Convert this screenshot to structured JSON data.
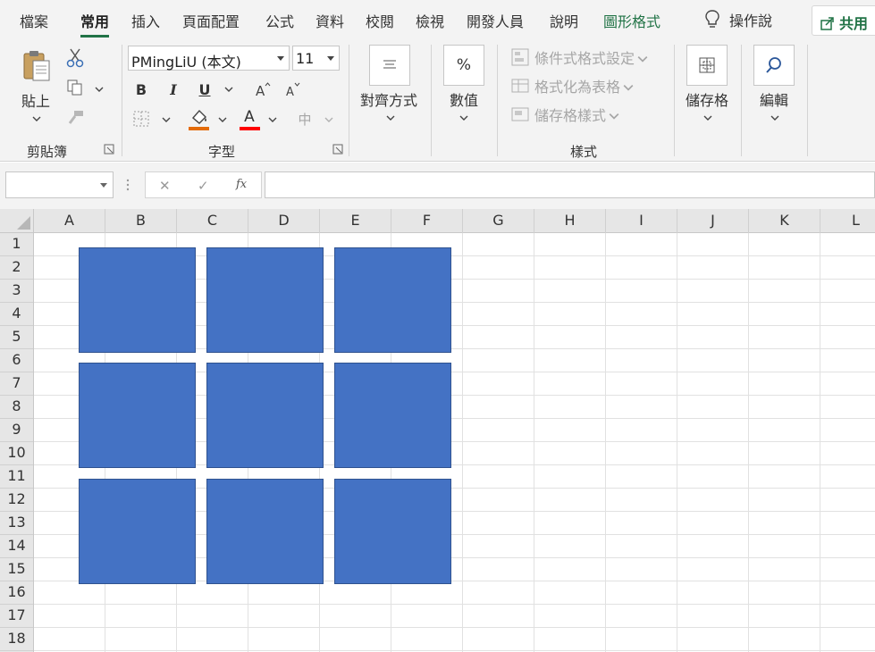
{
  "menu": {
    "tabs": [
      {
        "label": "檔案",
        "state": "normal"
      },
      {
        "label": "常用",
        "state": "active"
      },
      {
        "label": "插入",
        "state": "normal"
      },
      {
        "label": "頁面配置",
        "state": "normal"
      },
      {
        "label": "公式",
        "state": "normal"
      },
      {
        "label": "資料",
        "state": "normal"
      },
      {
        "label": "校閱",
        "state": "normal"
      },
      {
        "label": "檢視",
        "state": "normal"
      },
      {
        "label": "開發人員",
        "state": "normal"
      },
      {
        "label": "說明",
        "state": "normal"
      },
      {
        "label": "圖形格式",
        "state": "contextual"
      }
    ],
    "tell_me": "操作說",
    "share": "共用"
  },
  "ribbon": {
    "clipboard": {
      "paste_label": "貼上",
      "group_label": "剪貼簿"
    },
    "font": {
      "font_name": "PMingLiU (本文)",
      "font_size": "11",
      "bold": "B",
      "italic": "I",
      "underline": "U",
      "font_color_glyph": "A",
      "phonetic_glyph": "中",
      "group_label": "字型",
      "fill_color": "#e46c0a",
      "font_color": "#ff0000"
    },
    "alignment": {
      "label": "對齊方式"
    },
    "number": {
      "label": "數值",
      "glyph": "%"
    },
    "styles": {
      "conditional_formatting": "條件式格式設定",
      "format_as_table": "格式化為表格",
      "cell_styles": "儲存格樣式",
      "group_label": "樣式"
    },
    "cells": {
      "label": "儲存格"
    },
    "editing": {
      "label": "編輯"
    }
  },
  "formula_bar": {
    "cancel": "✕",
    "enter": "✓",
    "fx": "fx"
  },
  "sheet": {
    "columns": [
      "A",
      "B",
      "C",
      "D",
      "E",
      "F",
      "G",
      "H",
      "I",
      "J",
      "K",
      "L"
    ],
    "rows": [
      "1",
      "2",
      "3",
      "4",
      "5",
      "6",
      "7",
      "8",
      "9",
      "10",
      "11",
      "12",
      "13",
      "14",
      "15",
      "16",
      "17",
      "18"
    ],
    "shape_fill": "#4472c4",
    "shape_grid": {
      "rows": 3,
      "cols": 3
    }
  },
  "colors": {
    "accent": "#217346"
  }
}
